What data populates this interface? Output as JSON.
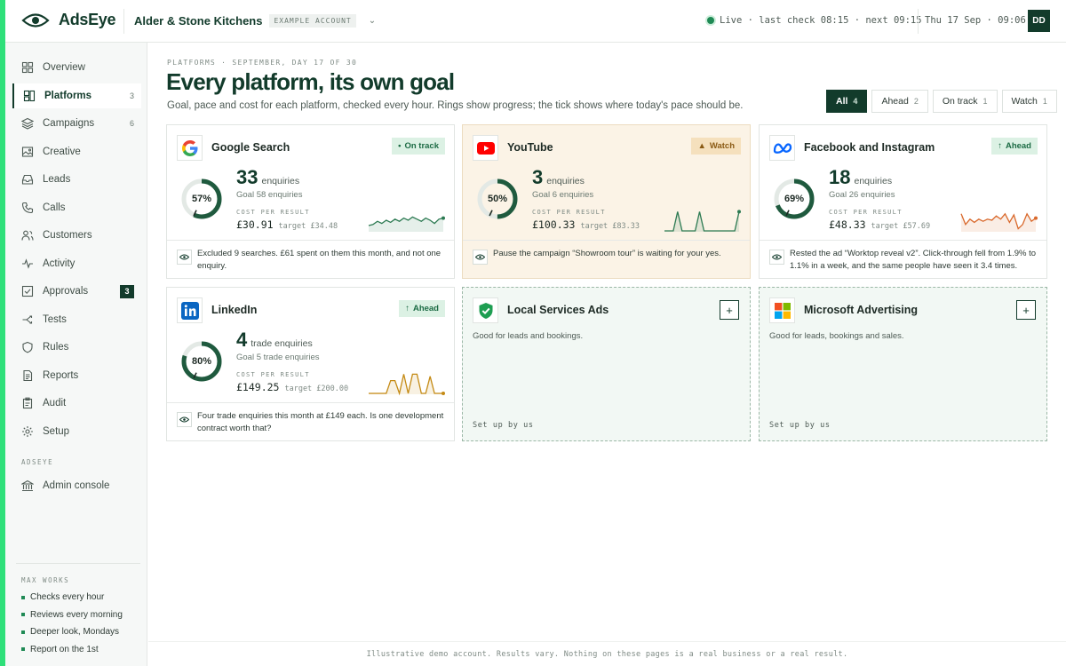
{
  "brand": {
    "name": "AdsEye",
    "accent": "#2fe07a",
    "primary": "#123b2b"
  },
  "header": {
    "account_name": "Alder & Stone Kitchens",
    "account_tag": "EXAMPLE ACCOUNT",
    "live_text": "Live · last check 08:15 · next 09:15",
    "datetime": "Thu 17 Sep · 09:06",
    "avatar": "DD"
  },
  "sidebar": {
    "items": [
      {
        "label": "Overview",
        "icon": "grid-icon"
      },
      {
        "label": "Platforms",
        "icon": "platforms-icon",
        "count": "3",
        "active": true
      },
      {
        "label": "Campaigns",
        "icon": "layers-icon",
        "count": "6"
      },
      {
        "label": "Creative",
        "icon": "image-icon"
      },
      {
        "label": "Leads",
        "icon": "inbox-icon"
      },
      {
        "label": "Calls",
        "icon": "phone-icon"
      },
      {
        "label": "Customers",
        "icon": "users-icon"
      },
      {
        "label": "Activity",
        "icon": "pulse-icon"
      },
      {
        "label": "Approvals",
        "icon": "check-square-icon",
        "badge": "3"
      },
      {
        "label": "Tests",
        "icon": "split-icon"
      },
      {
        "label": "Rules",
        "icon": "shield-icon"
      },
      {
        "label": "Reports",
        "icon": "document-icon"
      },
      {
        "label": "Audit",
        "icon": "clipboard-icon"
      },
      {
        "label": "Setup",
        "icon": "gear-icon"
      }
    ],
    "section_label": "ADSEYE",
    "admin": {
      "label": "Admin console",
      "icon": "bank-icon"
    },
    "max_label": "MAX WORKS",
    "max_items": [
      "Checks every hour",
      "Reviews every morning",
      "Deeper look, Mondays",
      "Report on the 1st"
    ]
  },
  "main": {
    "breadcrumb": "PLATFORMS · SEPTEMBER, DAY 17 OF 30",
    "title": "Every platform, its own goal",
    "subtitle": "Goal, pace and cost for each platform, checked every hour. Rings show progress; the tick shows where today's pace should be.",
    "filters": [
      {
        "label": "All",
        "count": "4"
      },
      {
        "label": "Ahead",
        "count": "2"
      },
      {
        "label": "On track",
        "count": "1"
      },
      {
        "label": "Watch",
        "count": "1"
      }
    ],
    "cards": [
      {
        "name": "Google Search",
        "status": "On track",
        "status_icon": "•",
        "num": "33",
        "unit": "enquiries",
        "goal": "Goal 58 enquiries",
        "pct": "57%",
        "progress": 0.57,
        "tick": 0.57,
        "cpr_label": "COST PER RESULT",
        "cpr": "£30.91",
        "target": "target £34.48",
        "note": "Excluded 9 searches. £61 spent on them this month, and not one enquiry.",
        "spark": [
          0.25,
          0.3,
          0.45,
          0.35,
          0.5,
          0.4,
          0.55,
          0.45,
          0.6,
          0.5,
          0.65,
          0.55,
          0.45,
          0.6,
          0.5,
          0.35,
          0.55,
          0.6
        ],
        "spark_color": "#2c7a52"
      },
      {
        "name": "YouTube",
        "status": "Watch",
        "status_icon": "▲",
        "num": "3",
        "unit": "enquiries",
        "goal": "Goal 6 enquiries",
        "pct": "50%",
        "progress": 0.5,
        "tick": 0.57,
        "cpr_label": "COST PER RESULT",
        "cpr": "£100.33",
        "target": "target £83.33",
        "note": "Pause the campaign “Showroom tour” is waiting for your yes.",
        "spark": [
          0,
          0,
          0,
          0.9,
          0,
          0,
          0,
          0,
          0.9,
          0,
          0,
          0,
          0,
          0,
          0,
          0,
          0,
          0.9
        ],
        "spark_color": "#2c7a52"
      },
      {
        "name": "Facebook and Instagram",
        "status": "Ahead",
        "status_icon": "↑",
        "num": "18",
        "unit": "enquiries",
        "goal": "Goal 26 enquiries",
        "pct": "69%",
        "progress": 0.69,
        "tick": 0.57,
        "cpr_label": "COST PER RESULT",
        "cpr": "£48.33",
        "target": "target £57.69",
        "note": "Rested the ad “Worktop reveal v2”. Click-through fell from 1.9% to 1.1% in a week, and the same people have seen it 3.4 times.",
        "spark": [
          0.8,
          0.3,
          0.55,
          0.4,
          0.55,
          0.45,
          0.55,
          0.5,
          0.7,
          0.55,
          0.8,
          0.4,
          0.75,
          0.1,
          0.3,
          0.8,
          0.45,
          0.6
        ],
        "spark_color": "#d9682b"
      },
      {
        "name": "LinkedIn",
        "status": "Ahead",
        "status_icon": "↑",
        "num": "4",
        "unit": "trade enquiries",
        "goal": "Goal 5 trade enquiries",
        "pct": "80%",
        "progress": 0.8,
        "tick": 0.57,
        "cpr_label": "COST PER RESULT",
        "cpr": "£149.25",
        "target": "target £200.00",
        "note": "Four trade enquiries this month at £149 each. Is one development contract worth that?",
        "spark": [
          0,
          0,
          0,
          0,
          0,
          0.6,
          0.6,
          0,
          0.9,
          0,
          0.9,
          0.9,
          0,
          0,
          0.8,
          0,
          0,
          0
        ],
        "spark_color": "#c48a14"
      }
    ],
    "empty_cards": [
      {
        "name": "Local Services Ads",
        "desc": "Good for leads and bookings.",
        "setup": "Set up by us"
      },
      {
        "name": "Microsoft Advertising",
        "desc": "Good for leads, bookings and sales.",
        "setup": "Set up by us"
      }
    ]
  },
  "footer": "Illustrative demo account. Results vary. Nothing on these pages is a real business or a real result."
}
